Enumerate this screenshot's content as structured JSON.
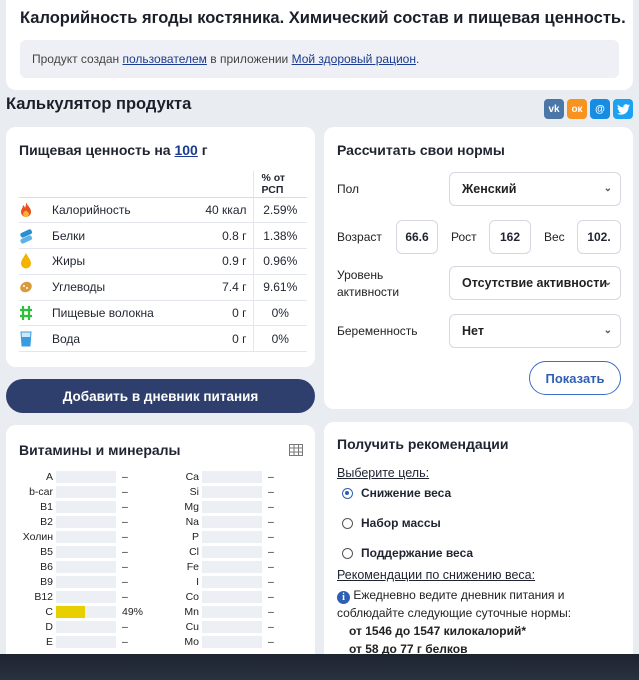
{
  "header": {
    "title": "Калорийность ягоды костяника. Химический состав и пищевая ценность.",
    "info_prefix": "Продукт создан ",
    "info_link_user": "пользователем",
    "info_middle": " в приложении ",
    "info_link_app": "Мой здоровый рацион",
    "info_suffix": "."
  },
  "calculator_title": "Калькулятор продукта",
  "share": [
    {
      "icon": "vk-icon",
      "label": "vk",
      "color": "#4a76a8"
    },
    {
      "icon": "ok-icon",
      "label": "ок",
      "color": "#f7931e"
    },
    {
      "icon": "moimir-icon",
      "label": "@",
      "color": "#168de2"
    },
    {
      "icon": "twitter-icon",
      "label": "t",
      "color": "#1da1f2"
    }
  ],
  "nutrition": {
    "title_prefix": "Пищевая ценность на ",
    "amount": "100",
    "unit": " г",
    "col_percent": "% от РСП",
    "rows": [
      {
        "icon": "fire-icon",
        "name": "Калорийность",
        "amount": "40 ккал",
        "percent": "2.59%",
        "color": "#e8501c"
      },
      {
        "icon": "protein-icon",
        "name": "Белки",
        "amount": "0.8 г",
        "percent": "1.38%",
        "color": "#2a8fd0"
      },
      {
        "icon": "fat-drop-icon",
        "name": "Жиры",
        "amount": "0.9 г",
        "percent": "0.96%",
        "color": "#f2b400"
      },
      {
        "icon": "carbs-icon",
        "name": "Углеводы",
        "amount": "7.4 г",
        "percent": "9.61%",
        "color": "#d89a3c"
      },
      {
        "icon": "fiber-icon",
        "name": "Пищевые волокна",
        "amount": "0 г",
        "percent": "0%",
        "color": "#2fbf3a"
      },
      {
        "icon": "water-glass-icon",
        "name": "Вода",
        "amount": "0 г",
        "percent": "0%",
        "color": "#3a9ce0"
      }
    ]
  },
  "add_to_diary": "Добавить в дневник питания",
  "norms": {
    "title": "Рассчитать свои нормы",
    "sex_label": "Пол",
    "sex_value": "Женский",
    "age_label": "Возраст",
    "age_value": "66.6",
    "height_label": "Рост",
    "height_value": "162",
    "weight_label": "Вес",
    "weight_value": "102.",
    "activity_label_1": "Уровень",
    "activity_label_2": "активности",
    "activity_value": "Отсутствие активности",
    "pregnancy_label": "Беременность",
    "pregnancy_value": "Нет",
    "show_button": "Показать"
  },
  "vitamins": {
    "title": "Витамины и минералы",
    "left": [
      {
        "name": "A",
        "value": "–",
        "fill": 0
      },
      {
        "name": "b-car",
        "value": "–",
        "fill": 0
      },
      {
        "name": "B1",
        "value": "–",
        "fill": 0
      },
      {
        "name": "B2",
        "value": "–",
        "fill": 0
      },
      {
        "name": "Холин",
        "value": "–",
        "fill": 0
      },
      {
        "name": "B5",
        "value": "–",
        "fill": 0
      },
      {
        "name": "B6",
        "value": "–",
        "fill": 0
      },
      {
        "name": "B9",
        "value": "–",
        "fill": 0
      },
      {
        "name": "B12",
        "value": "–",
        "fill": 0
      },
      {
        "name": "C",
        "value": "49%",
        "fill": 0.49
      },
      {
        "name": "D",
        "value": "–",
        "fill": 0
      },
      {
        "name": "E",
        "value": "–",
        "fill": 0
      }
    ],
    "right": [
      {
        "name": "Ca",
        "value": "–",
        "fill": 0
      },
      {
        "name": "Si",
        "value": "–",
        "fill": 0
      },
      {
        "name": "Mg",
        "value": "–",
        "fill": 0
      },
      {
        "name": "Na",
        "value": "–",
        "fill": 0
      },
      {
        "name": "P",
        "value": "–",
        "fill": 0
      },
      {
        "name": "Cl",
        "value": "–",
        "fill": 0
      },
      {
        "name": "Fe",
        "value": "–",
        "fill": 0
      },
      {
        "name": "I",
        "value": "–",
        "fill": 0
      },
      {
        "name": "Co",
        "value": "–",
        "fill": 0
      },
      {
        "name": "Mn",
        "value": "–",
        "fill": 0
      },
      {
        "name": "Cu",
        "value": "–",
        "fill": 0
      },
      {
        "name": "Mo",
        "value": "–",
        "fill": 0
      }
    ]
  },
  "recommendations": {
    "title": "Получить рекомендации",
    "goal_label": "Выберите цель:",
    "goals": [
      "Снижение веса",
      "Набор массы",
      "Поддержание веса"
    ],
    "selected_goal": "Снижение веса",
    "subtitle": "Рекомендации по снижению веса:",
    "text": " Ежедневно ведите дневник питания и соблюдайте следующие суточные нормы:",
    "line1": "от 1546 до 1547 килокалорий*",
    "line2": "от 58 до 77 г белков"
  }
}
